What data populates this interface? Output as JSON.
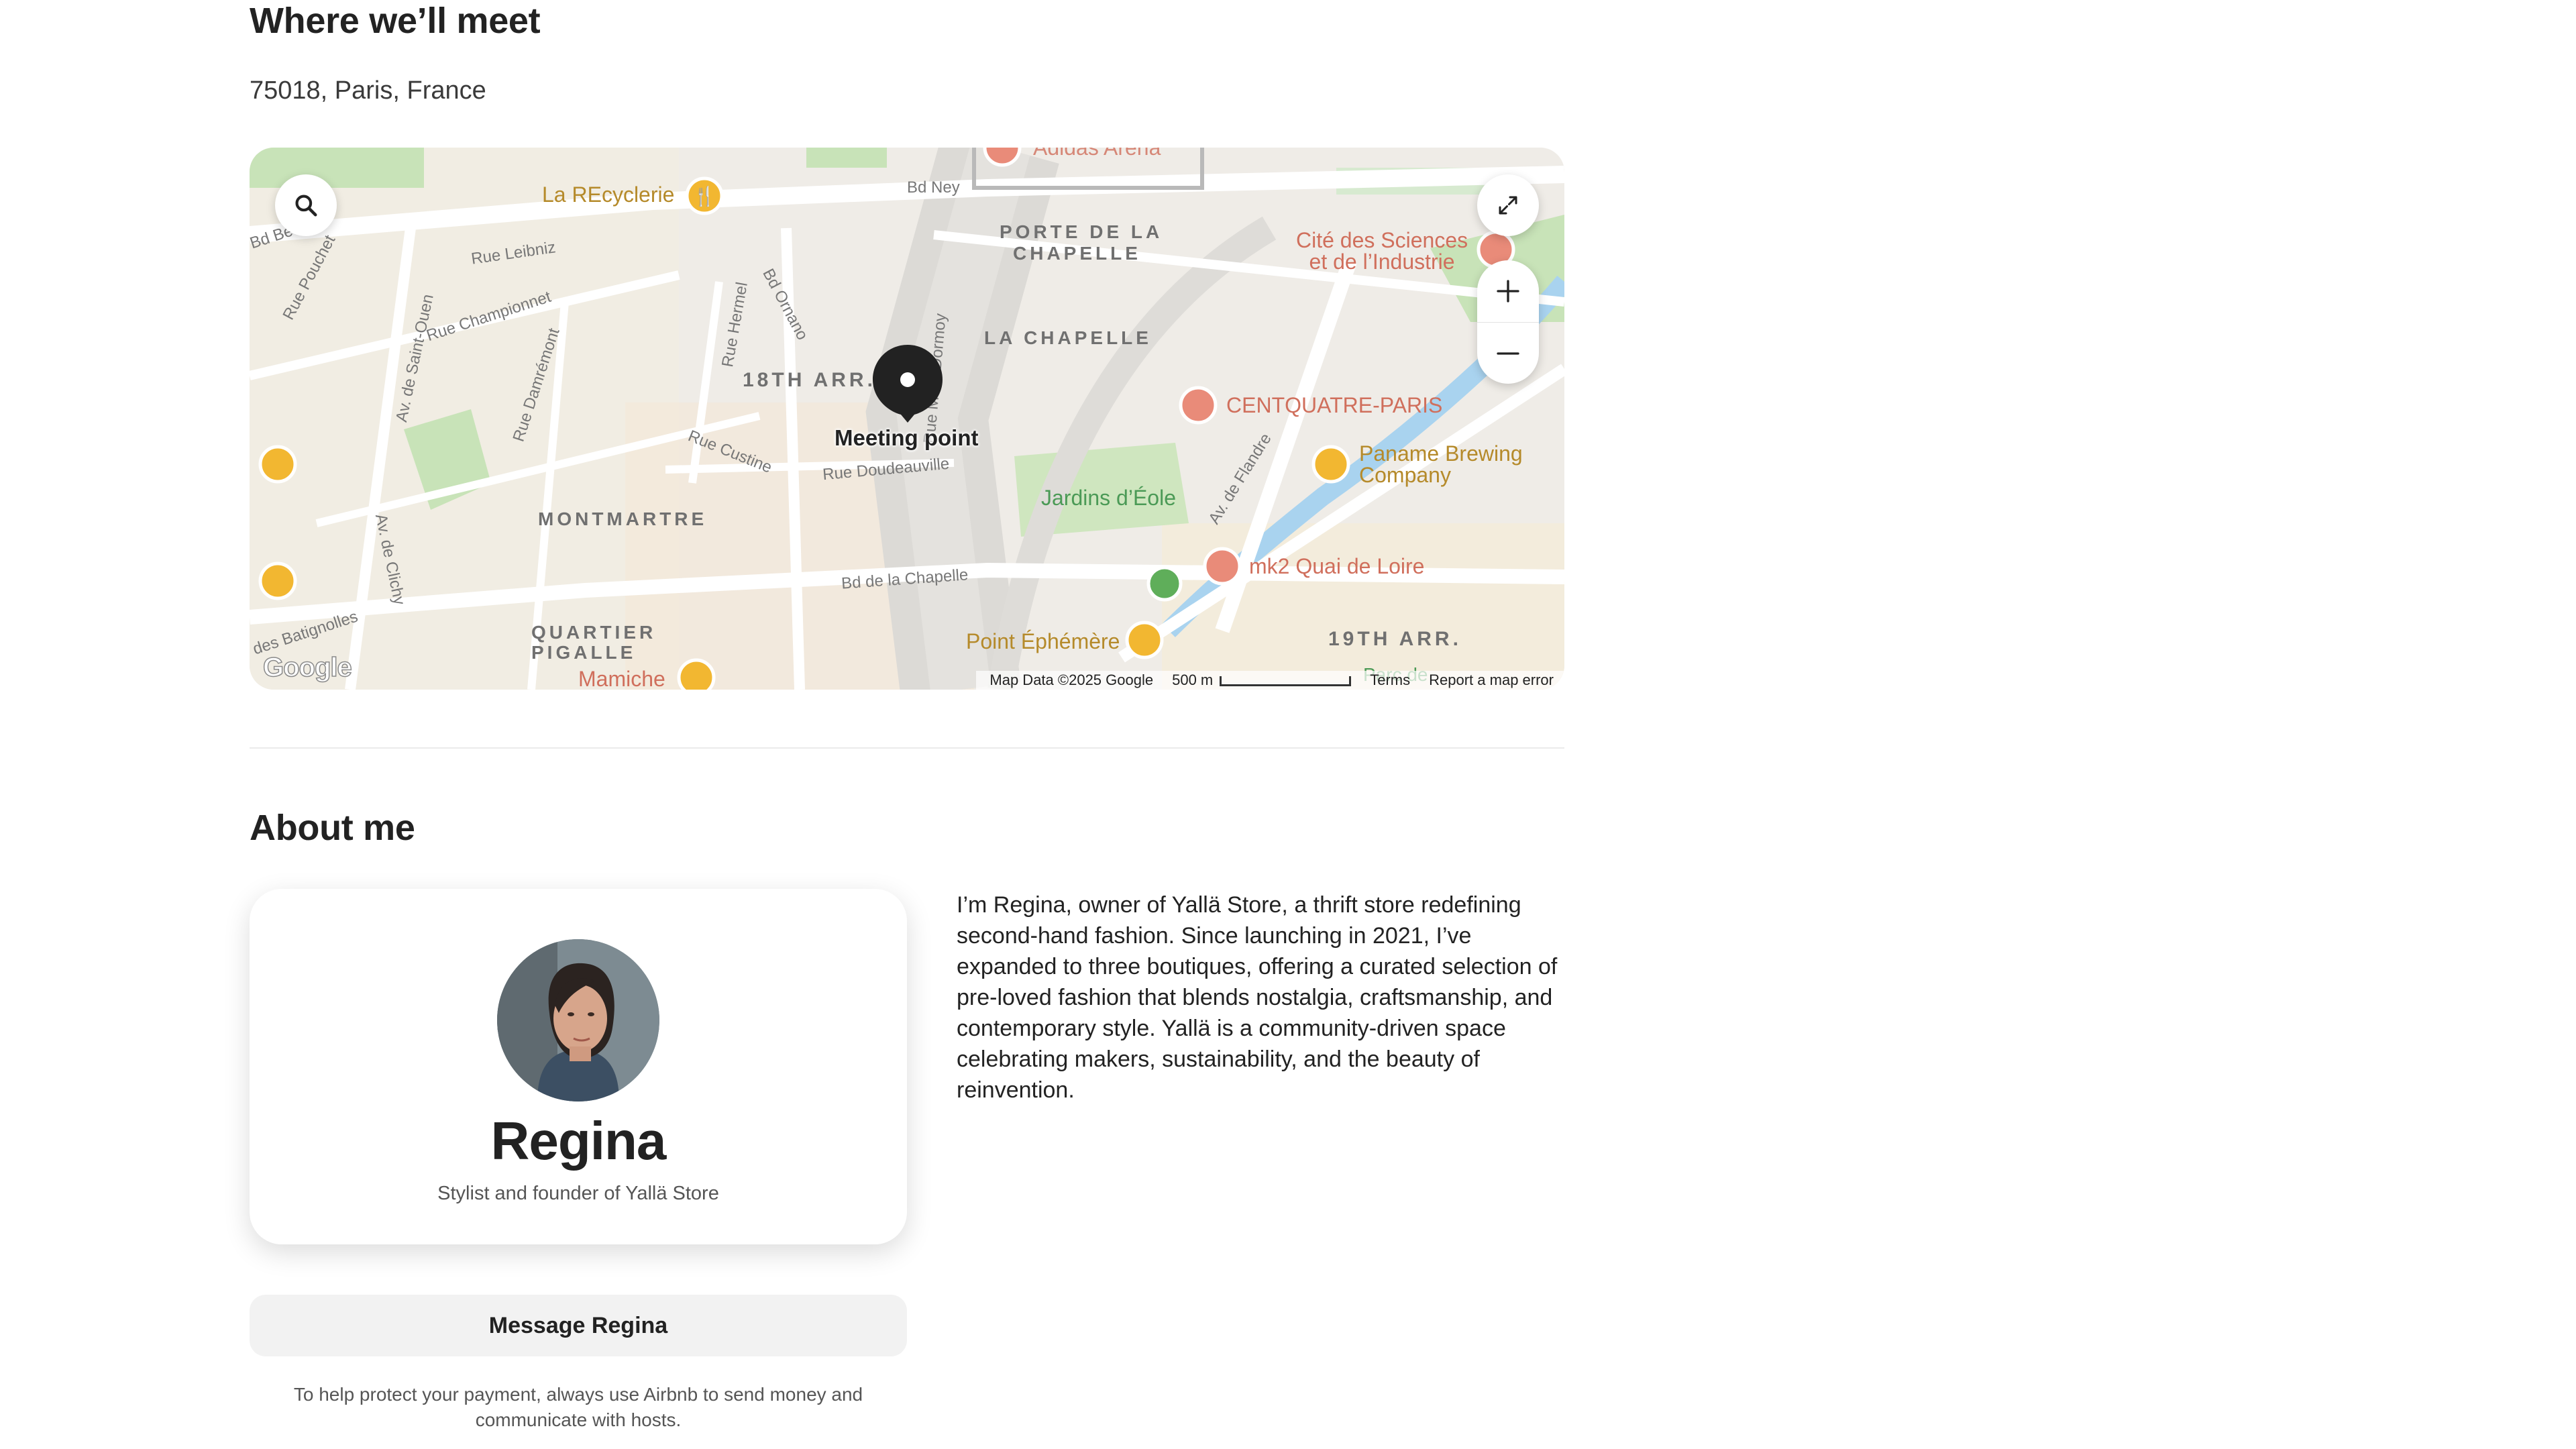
{
  "meet": {
    "title": "Where we’ll meet",
    "address": "75018, Paris, France"
  },
  "map": {
    "meeting_point_label": "Meeting point",
    "districts": {
      "arr18": "18TH ARR.",
      "porte_chapelle_1": "PORTE DE LA",
      "porte_chapelle_2": "CHAPELLE",
      "la_chapelle": "LA CHAPELLE",
      "montmartre": "MONTMARTRE",
      "pigalle_1": "QUARTIER",
      "pigalle_2": "PIGALLE",
      "arr19": "19TH ARR."
    },
    "streets": {
      "bd_ney": "Bd Ney",
      "rue_leibniz": "Rue Leibniz",
      "rue_championnet": "Rue Championnet",
      "rue_pouchet": "Rue Pouchet",
      "av_saint_ouen": "Av. de Saint-Ouen",
      "rue_damremont": "Rue Damrémont",
      "rue_hermel": "Rue Hermel",
      "bd_ornano": "Bd Ornano",
      "rue_custine": "Rue Custine",
      "rue_doudeauville": "Rue Doudeauville",
      "rue_marx_dormoy": "Rue Marx Dormoy",
      "bd_de_la_chapelle": "Bd de la Chapelle",
      "av_de_flandre": "Av. de Flandre",
      "av_de_clichy": "Av. de Clichy",
      "des_batignolles": "des Batignolles",
      "bd_be": "Bd Be"
    },
    "pois": {
      "la_recyclerie": "La REcyclerie",
      "cite_sciences_1": "Cité des Sciences",
      "cite_sciences_2": "et de l’Industrie",
      "centquatre": "CENTQUATRE-PARIS",
      "paname_1": "Paname Brewing",
      "paname_2": "Company",
      "jardins_eole": "Jardins d’Éole",
      "mk2": "mk2 Quai de Loire",
      "point_ephemere": "Point Éphémère",
      "mamiche": "Mamiche",
      "adidas_arena": "Adidas Arena",
      "parc_de": "Parc de"
    },
    "footer": {
      "map_data": "Map Data ©2025 Google",
      "scale": "500 m",
      "terms": "Terms",
      "report": "Report a map error"
    },
    "logo": "Google",
    "icons": {
      "search": "search-icon",
      "expand": "expand-icon",
      "zoom_in": "plus-icon",
      "zoom_out": "minus-icon",
      "pin": "map-pin-icon"
    }
  },
  "about": {
    "title": "About me",
    "host": {
      "name": "Regina",
      "subtitle": "Stylist and founder of Yallä Store"
    },
    "bio": "I’m Regina, owner of Yallä Store, a thrift store redefining second-hand fashion. Since launching in 2021, I’ve expanded to three boutiques, offering a curated selection of pre-loved fashion that blends nostalgia, craftsmanship, and contemporary style. Yallä is a community-driven space celebrating makers, sustainability, and the beauty of reinvention.",
    "message_button": "Message Regina",
    "payment_note": "To help protect your payment, always use Airbnb to send money and communicate with hosts."
  },
  "colors": {
    "text": "#222222",
    "muted": "#555555",
    "map_background": "#efece7",
    "park_green": "#c8e3b8",
    "water": "#a9d3ef",
    "poi_orange": "#f2b731",
    "poi_red": "#e98b79"
  }
}
